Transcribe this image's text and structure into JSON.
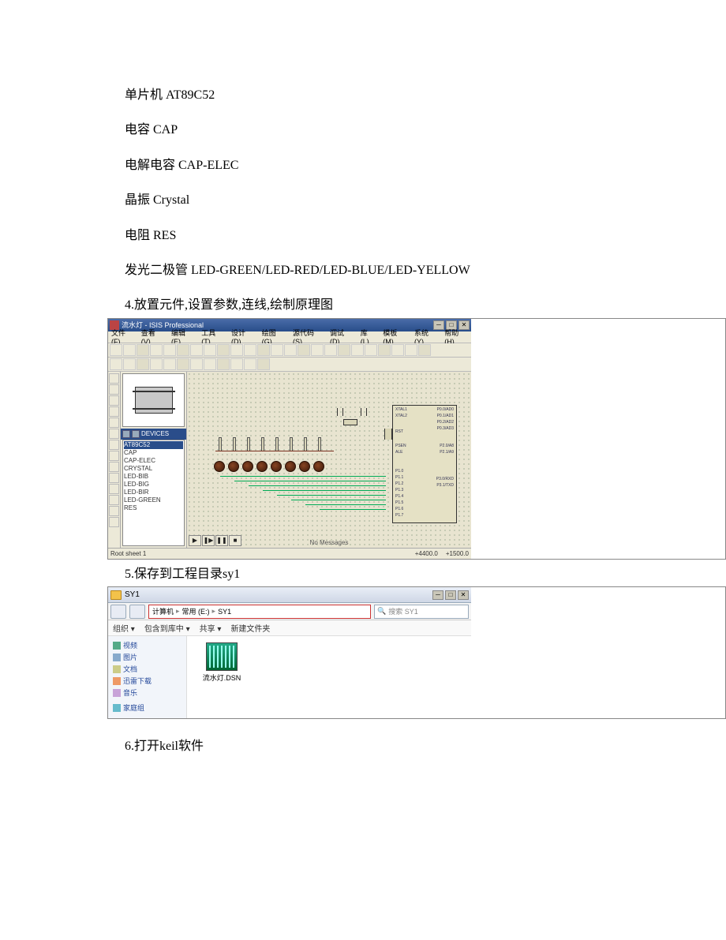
{
  "lines": {
    "l1": "单片机 AT89C52",
    "l2": "电容 CAP",
    "l3": "电解电容 CAP-ELEC",
    "l4": "晶振 Crystal",
    "l5": "电阻 RES",
    "l6": "发光二极管 LED-GREEN/LED-RED/LED-BLUE/LED-YELLOW",
    "step4": "4.放置元件,设置参数,连线,绘制原理图",
    "step5": "5.保存到工程目录sy1",
    "step6": "6.打开keil软件"
  },
  "isis": {
    "title": "流水灯 - ISIS Professional",
    "menus": [
      "文件(F)",
      "查看(V)",
      "编辑(E)",
      "工具(T)",
      "设计(D)",
      "绘图(G)",
      "源代码(S)",
      "调试(D)",
      "库(L)",
      "模板(M)",
      "系统(Y)",
      "帮助(H)"
    ],
    "devicesHeader": "DEVICES",
    "deviceList": [
      "AT89C52",
      "CAP",
      "CAP-ELEC",
      "CRYSTAL",
      "LED-BIB",
      "LED-BIG",
      "LED-BIR",
      "LED-GREEN",
      "RES"
    ],
    "noMessages": "No Messages",
    "statusLeft": "Root sheet 1",
    "coordX": "+4400.0",
    "coordY": "+1500.0"
  },
  "explorer": {
    "title": "SY1",
    "crumbs": [
      "计算机",
      "常用 (E:)",
      "SY1"
    ],
    "searchPlaceholder": "搜索 SY1",
    "toolbar": [
      "组织 ▾",
      "包含到库中 ▾",
      "共享 ▾",
      "新建文件夹"
    ],
    "sidebar": [
      {
        "icon": "ico-video",
        "label": "视频"
      },
      {
        "icon": "ico-img",
        "label": "图片"
      },
      {
        "icon": "ico-doc",
        "label": "文档"
      },
      {
        "icon": "ico-dl",
        "label": "迅雷下载"
      },
      {
        "icon": "ico-music",
        "label": "音乐"
      }
    ],
    "sidebarHome": "家庭组",
    "fileName": "流水灯.DSN"
  }
}
